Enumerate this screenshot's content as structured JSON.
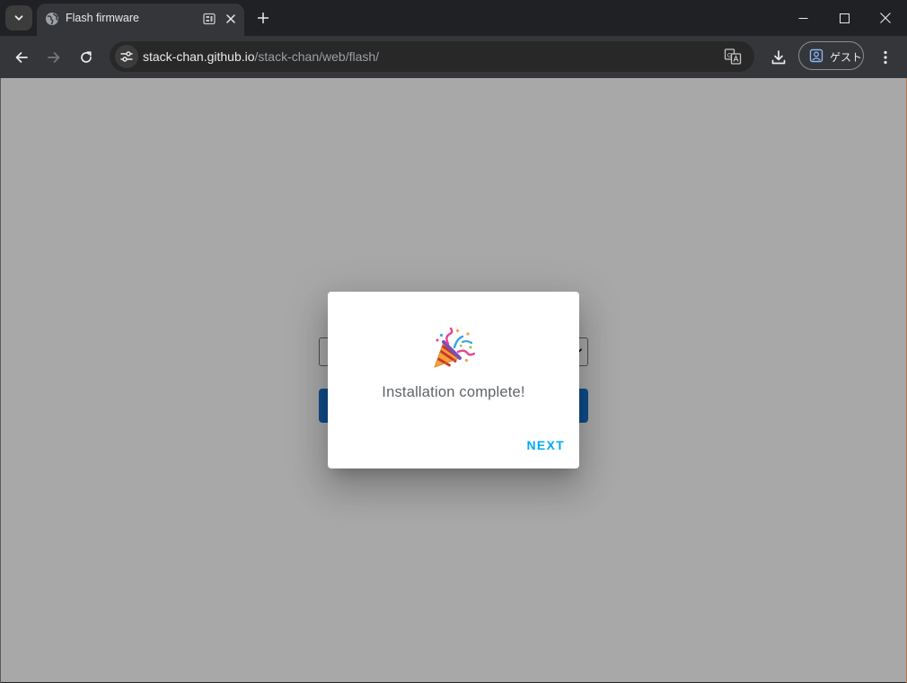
{
  "tab": {
    "title": "Flash firmware"
  },
  "omnibox": {
    "host": "stack-chan.github.io",
    "path": "/stack-chan/web/flash/"
  },
  "profile": {
    "label": "ゲスト"
  },
  "dialog": {
    "message": "Installation complete!",
    "next_label": "NEXT"
  },
  "colors": {
    "accent": "#03a9f4",
    "page_button": "#1976d2",
    "browser_frame": "#202124",
    "toolbar": "#35363a"
  },
  "icons": {
    "tab_search": "chevron-down-icon",
    "favicon": "globe-icon",
    "tab_media": "media-icon",
    "tab_close": "close-icon",
    "new_tab": "plus-icon",
    "minimize": "minimize-icon",
    "maximize": "maximize-icon",
    "close_window": "close-icon",
    "back": "arrow-left-icon",
    "forward": "arrow-right-icon",
    "reload": "reload-icon",
    "site_info": "tune-icon",
    "translate": "translate-icon",
    "download": "download-icon",
    "guest": "guest-profile-icon",
    "menu": "kebab-menu-icon",
    "celebration": "party-popper-icon"
  }
}
